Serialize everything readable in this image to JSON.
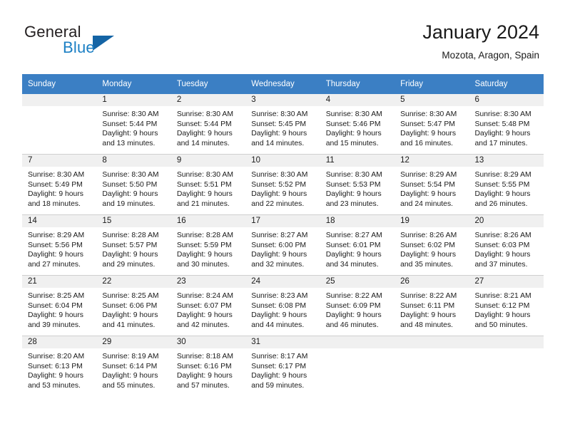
{
  "brand": {
    "name_part1": "General",
    "name_part2": "Blue",
    "triangle_color": "#1464a5",
    "blue_color": "#1b7fc4"
  },
  "header": {
    "title": "January 2024",
    "subtitle": "Mozota, Aragon, Spain"
  },
  "theme": {
    "header_row_bg": "#3b7fc4",
    "header_row_text": "#ffffff",
    "daynum_band_bg": "#f0f0f0",
    "cell_border": "#cfcfcf"
  },
  "weekday_headers": [
    "Sunday",
    "Monday",
    "Tuesday",
    "Wednesday",
    "Thursday",
    "Friday",
    "Saturday"
  ],
  "labels": {
    "sunrise_prefix": "Sunrise:",
    "sunset_prefix": "Sunset:",
    "daylight_prefix": "Daylight:"
  },
  "weeks": [
    [
      {
        "day": "",
        "l1": "",
        "l2": "",
        "l3": "",
        "l4": ""
      },
      {
        "day": "1",
        "l1": "Sunrise: 8:30 AM",
        "l2": "Sunset: 5:44 PM",
        "l3": "Daylight: 9 hours",
        "l4": "and 13 minutes."
      },
      {
        "day": "2",
        "l1": "Sunrise: 8:30 AM",
        "l2": "Sunset: 5:44 PM",
        "l3": "Daylight: 9 hours",
        "l4": "and 14 minutes."
      },
      {
        "day": "3",
        "l1": "Sunrise: 8:30 AM",
        "l2": "Sunset: 5:45 PM",
        "l3": "Daylight: 9 hours",
        "l4": "and 14 minutes."
      },
      {
        "day": "4",
        "l1": "Sunrise: 8:30 AM",
        "l2": "Sunset: 5:46 PM",
        "l3": "Daylight: 9 hours",
        "l4": "and 15 minutes."
      },
      {
        "day": "5",
        "l1": "Sunrise: 8:30 AM",
        "l2": "Sunset: 5:47 PM",
        "l3": "Daylight: 9 hours",
        "l4": "and 16 minutes."
      },
      {
        "day": "6",
        "l1": "Sunrise: 8:30 AM",
        "l2": "Sunset: 5:48 PM",
        "l3": "Daylight: 9 hours",
        "l4": "and 17 minutes."
      }
    ],
    [
      {
        "day": "7",
        "l1": "Sunrise: 8:30 AM",
        "l2": "Sunset: 5:49 PM",
        "l3": "Daylight: 9 hours",
        "l4": "and 18 minutes."
      },
      {
        "day": "8",
        "l1": "Sunrise: 8:30 AM",
        "l2": "Sunset: 5:50 PM",
        "l3": "Daylight: 9 hours",
        "l4": "and 19 minutes."
      },
      {
        "day": "9",
        "l1": "Sunrise: 8:30 AM",
        "l2": "Sunset: 5:51 PM",
        "l3": "Daylight: 9 hours",
        "l4": "and 21 minutes."
      },
      {
        "day": "10",
        "l1": "Sunrise: 8:30 AM",
        "l2": "Sunset: 5:52 PM",
        "l3": "Daylight: 9 hours",
        "l4": "and 22 minutes."
      },
      {
        "day": "11",
        "l1": "Sunrise: 8:30 AM",
        "l2": "Sunset: 5:53 PM",
        "l3": "Daylight: 9 hours",
        "l4": "and 23 minutes."
      },
      {
        "day": "12",
        "l1": "Sunrise: 8:29 AM",
        "l2": "Sunset: 5:54 PM",
        "l3": "Daylight: 9 hours",
        "l4": "and 24 minutes."
      },
      {
        "day": "13",
        "l1": "Sunrise: 8:29 AM",
        "l2": "Sunset: 5:55 PM",
        "l3": "Daylight: 9 hours",
        "l4": "and 26 minutes."
      }
    ],
    [
      {
        "day": "14",
        "l1": "Sunrise: 8:29 AM",
        "l2": "Sunset: 5:56 PM",
        "l3": "Daylight: 9 hours",
        "l4": "and 27 minutes."
      },
      {
        "day": "15",
        "l1": "Sunrise: 8:28 AM",
        "l2": "Sunset: 5:57 PM",
        "l3": "Daylight: 9 hours",
        "l4": "and 29 minutes."
      },
      {
        "day": "16",
        "l1": "Sunrise: 8:28 AM",
        "l2": "Sunset: 5:59 PM",
        "l3": "Daylight: 9 hours",
        "l4": "and 30 minutes."
      },
      {
        "day": "17",
        "l1": "Sunrise: 8:27 AM",
        "l2": "Sunset: 6:00 PM",
        "l3": "Daylight: 9 hours",
        "l4": "and 32 minutes."
      },
      {
        "day": "18",
        "l1": "Sunrise: 8:27 AM",
        "l2": "Sunset: 6:01 PM",
        "l3": "Daylight: 9 hours",
        "l4": "and 34 minutes."
      },
      {
        "day": "19",
        "l1": "Sunrise: 8:26 AM",
        "l2": "Sunset: 6:02 PM",
        "l3": "Daylight: 9 hours",
        "l4": "and 35 minutes."
      },
      {
        "day": "20",
        "l1": "Sunrise: 8:26 AM",
        "l2": "Sunset: 6:03 PM",
        "l3": "Daylight: 9 hours",
        "l4": "and 37 minutes."
      }
    ],
    [
      {
        "day": "21",
        "l1": "Sunrise: 8:25 AM",
        "l2": "Sunset: 6:04 PM",
        "l3": "Daylight: 9 hours",
        "l4": "and 39 minutes."
      },
      {
        "day": "22",
        "l1": "Sunrise: 8:25 AM",
        "l2": "Sunset: 6:06 PM",
        "l3": "Daylight: 9 hours",
        "l4": "and 41 minutes."
      },
      {
        "day": "23",
        "l1": "Sunrise: 8:24 AM",
        "l2": "Sunset: 6:07 PM",
        "l3": "Daylight: 9 hours",
        "l4": "and 42 minutes."
      },
      {
        "day": "24",
        "l1": "Sunrise: 8:23 AM",
        "l2": "Sunset: 6:08 PM",
        "l3": "Daylight: 9 hours",
        "l4": "and 44 minutes."
      },
      {
        "day": "25",
        "l1": "Sunrise: 8:22 AM",
        "l2": "Sunset: 6:09 PM",
        "l3": "Daylight: 9 hours",
        "l4": "and 46 minutes."
      },
      {
        "day": "26",
        "l1": "Sunrise: 8:22 AM",
        "l2": "Sunset: 6:11 PM",
        "l3": "Daylight: 9 hours",
        "l4": "and 48 minutes."
      },
      {
        "day": "27",
        "l1": "Sunrise: 8:21 AM",
        "l2": "Sunset: 6:12 PM",
        "l3": "Daylight: 9 hours",
        "l4": "and 50 minutes."
      }
    ],
    [
      {
        "day": "28",
        "l1": "Sunrise: 8:20 AM",
        "l2": "Sunset: 6:13 PM",
        "l3": "Daylight: 9 hours",
        "l4": "and 53 minutes."
      },
      {
        "day": "29",
        "l1": "Sunrise: 8:19 AM",
        "l2": "Sunset: 6:14 PM",
        "l3": "Daylight: 9 hours",
        "l4": "and 55 minutes."
      },
      {
        "day": "30",
        "l1": "Sunrise: 8:18 AM",
        "l2": "Sunset: 6:16 PM",
        "l3": "Daylight: 9 hours",
        "l4": "and 57 minutes."
      },
      {
        "day": "31",
        "l1": "Sunrise: 8:17 AM",
        "l2": "Sunset: 6:17 PM",
        "l3": "Daylight: 9 hours",
        "l4": "and 59 minutes."
      },
      {
        "day": "",
        "l1": "",
        "l2": "",
        "l3": "",
        "l4": ""
      },
      {
        "day": "",
        "l1": "",
        "l2": "",
        "l3": "",
        "l4": ""
      },
      {
        "day": "",
        "l1": "",
        "l2": "",
        "l3": "",
        "l4": ""
      }
    ]
  ]
}
